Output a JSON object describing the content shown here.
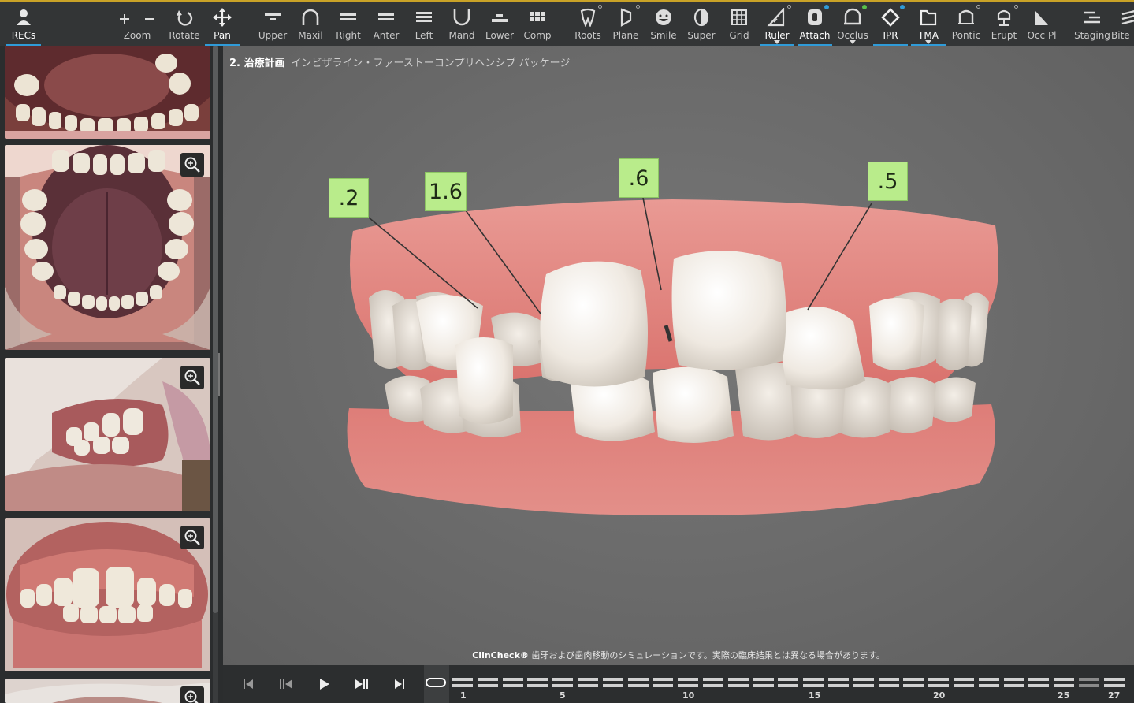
{
  "toolbar": {
    "items": [
      {
        "id": "recs",
        "label": "RECs",
        "icon": "person-icon"
      },
      {
        "id": "zoom",
        "label": "Zoom",
        "icon": "plus-minus-icon"
      },
      {
        "id": "rotate",
        "label": "Rotate",
        "icon": "rotate-icon"
      },
      {
        "id": "pan",
        "label": "Pan",
        "icon": "pan-arrows-icon"
      },
      {
        "id": "upper",
        "label": "Upper",
        "icon": "upper-jaw-icon"
      },
      {
        "id": "maxil",
        "label": "Maxil",
        "icon": "maxillary-arch-icon"
      },
      {
        "id": "right",
        "label": "Right",
        "icon": "right-view-icon"
      },
      {
        "id": "anter",
        "label": "Anter",
        "icon": "anterior-view-icon"
      },
      {
        "id": "left",
        "label": "Left",
        "icon": "left-view-icon"
      },
      {
        "id": "mand",
        "label": "Mand",
        "icon": "mandibular-arch-icon"
      },
      {
        "id": "lower",
        "label": "Lower",
        "icon": "lower-jaw-icon"
      },
      {
        "id": "comp",
        "label": "Comp",
        "icon": "compare-grid-icon"
      },
      {
        "id": "roots",
        "label": "Roots",
        "icon": "tooth-roots-icon"
      },
      {
        "id": "plane",
        "label": "Plane",
        "icon": "plane-icon"
      },
      {
        "id": "smile",
        "label": "Smile",
        "icon": "smile-icon"
      },
      {
        "id": "super",
        "label": "Super",
        "icon": "superimpose-icon"
      },
      {
        "id": "grid",
        "label": "Grid",
        "icon": "grid-icon"
      },
      {
        "id": "ruler",
        "label": "Ruler",
        "icon": "ruler-icon"
      },
      {
        "id": "attach",
        "label": "Attach",
        "icon": "attachment-icon"
      },
      {
        "id": "occlus",
        "label": "Occlus",
        "icon": "occlusion-icon"
      },
      {
        "id": "ipr",
        "label": "IPR",
        "icon": "ipr-diamond-icon"
      },
      {
        "id": "tma",
        "label": "TMA",
        "icon": "tma-folder-icon"
      },
      {
        "id": "pontic",
        "label": "Pontic",
        "icon": "pontic-icon"
      },
      {
        "id": "erupt",
        "label": "Erupt",
        "icon": "erupt-icon"
      },
      {
        "id": "occpl",
        "label": "Occ Pl",
        "icon": "occlusal-plane-icon"
      },
      {
        "id": "staging",
        "label": "Staging",
        "icon": "staging-icon"
      },
      {
        "id": "bite",
        "label": "Bite",
        "icon": "bite-icon"
      }
    ]
  },
  "viewport": {
    "heading_number": "2. 治療計画",
    "heading_package": "インビザライン・ファーストーコンプリヘンシブ パッケージ",
    "disclaimer_brand": "ClinCheck®",
    "disclaimer_text": " 歯牙および歯肉移動のシミュレーションです。実際の臨床結果とは異なる場合があります。",
    "ipr_labels": [
      ".2",
      "1.6",
      ".6",
      ".5"
    ]
  },
  "photos": {
    "zoom_icon": "magnifier-plus-icon"
  },
  "timeline": {
    "tick_labels": [
      "1",
      "5",
      "10",
      "15",
      "20",
      "25",
      "27"
    ]
  },
  "colors": {
    "accent": "#2f9bd8",
    "ipr_label_bg": "#b9ec8b",
    "gum": "#e07f7a",
    "tooth": "#ece6dc"
  }
}
